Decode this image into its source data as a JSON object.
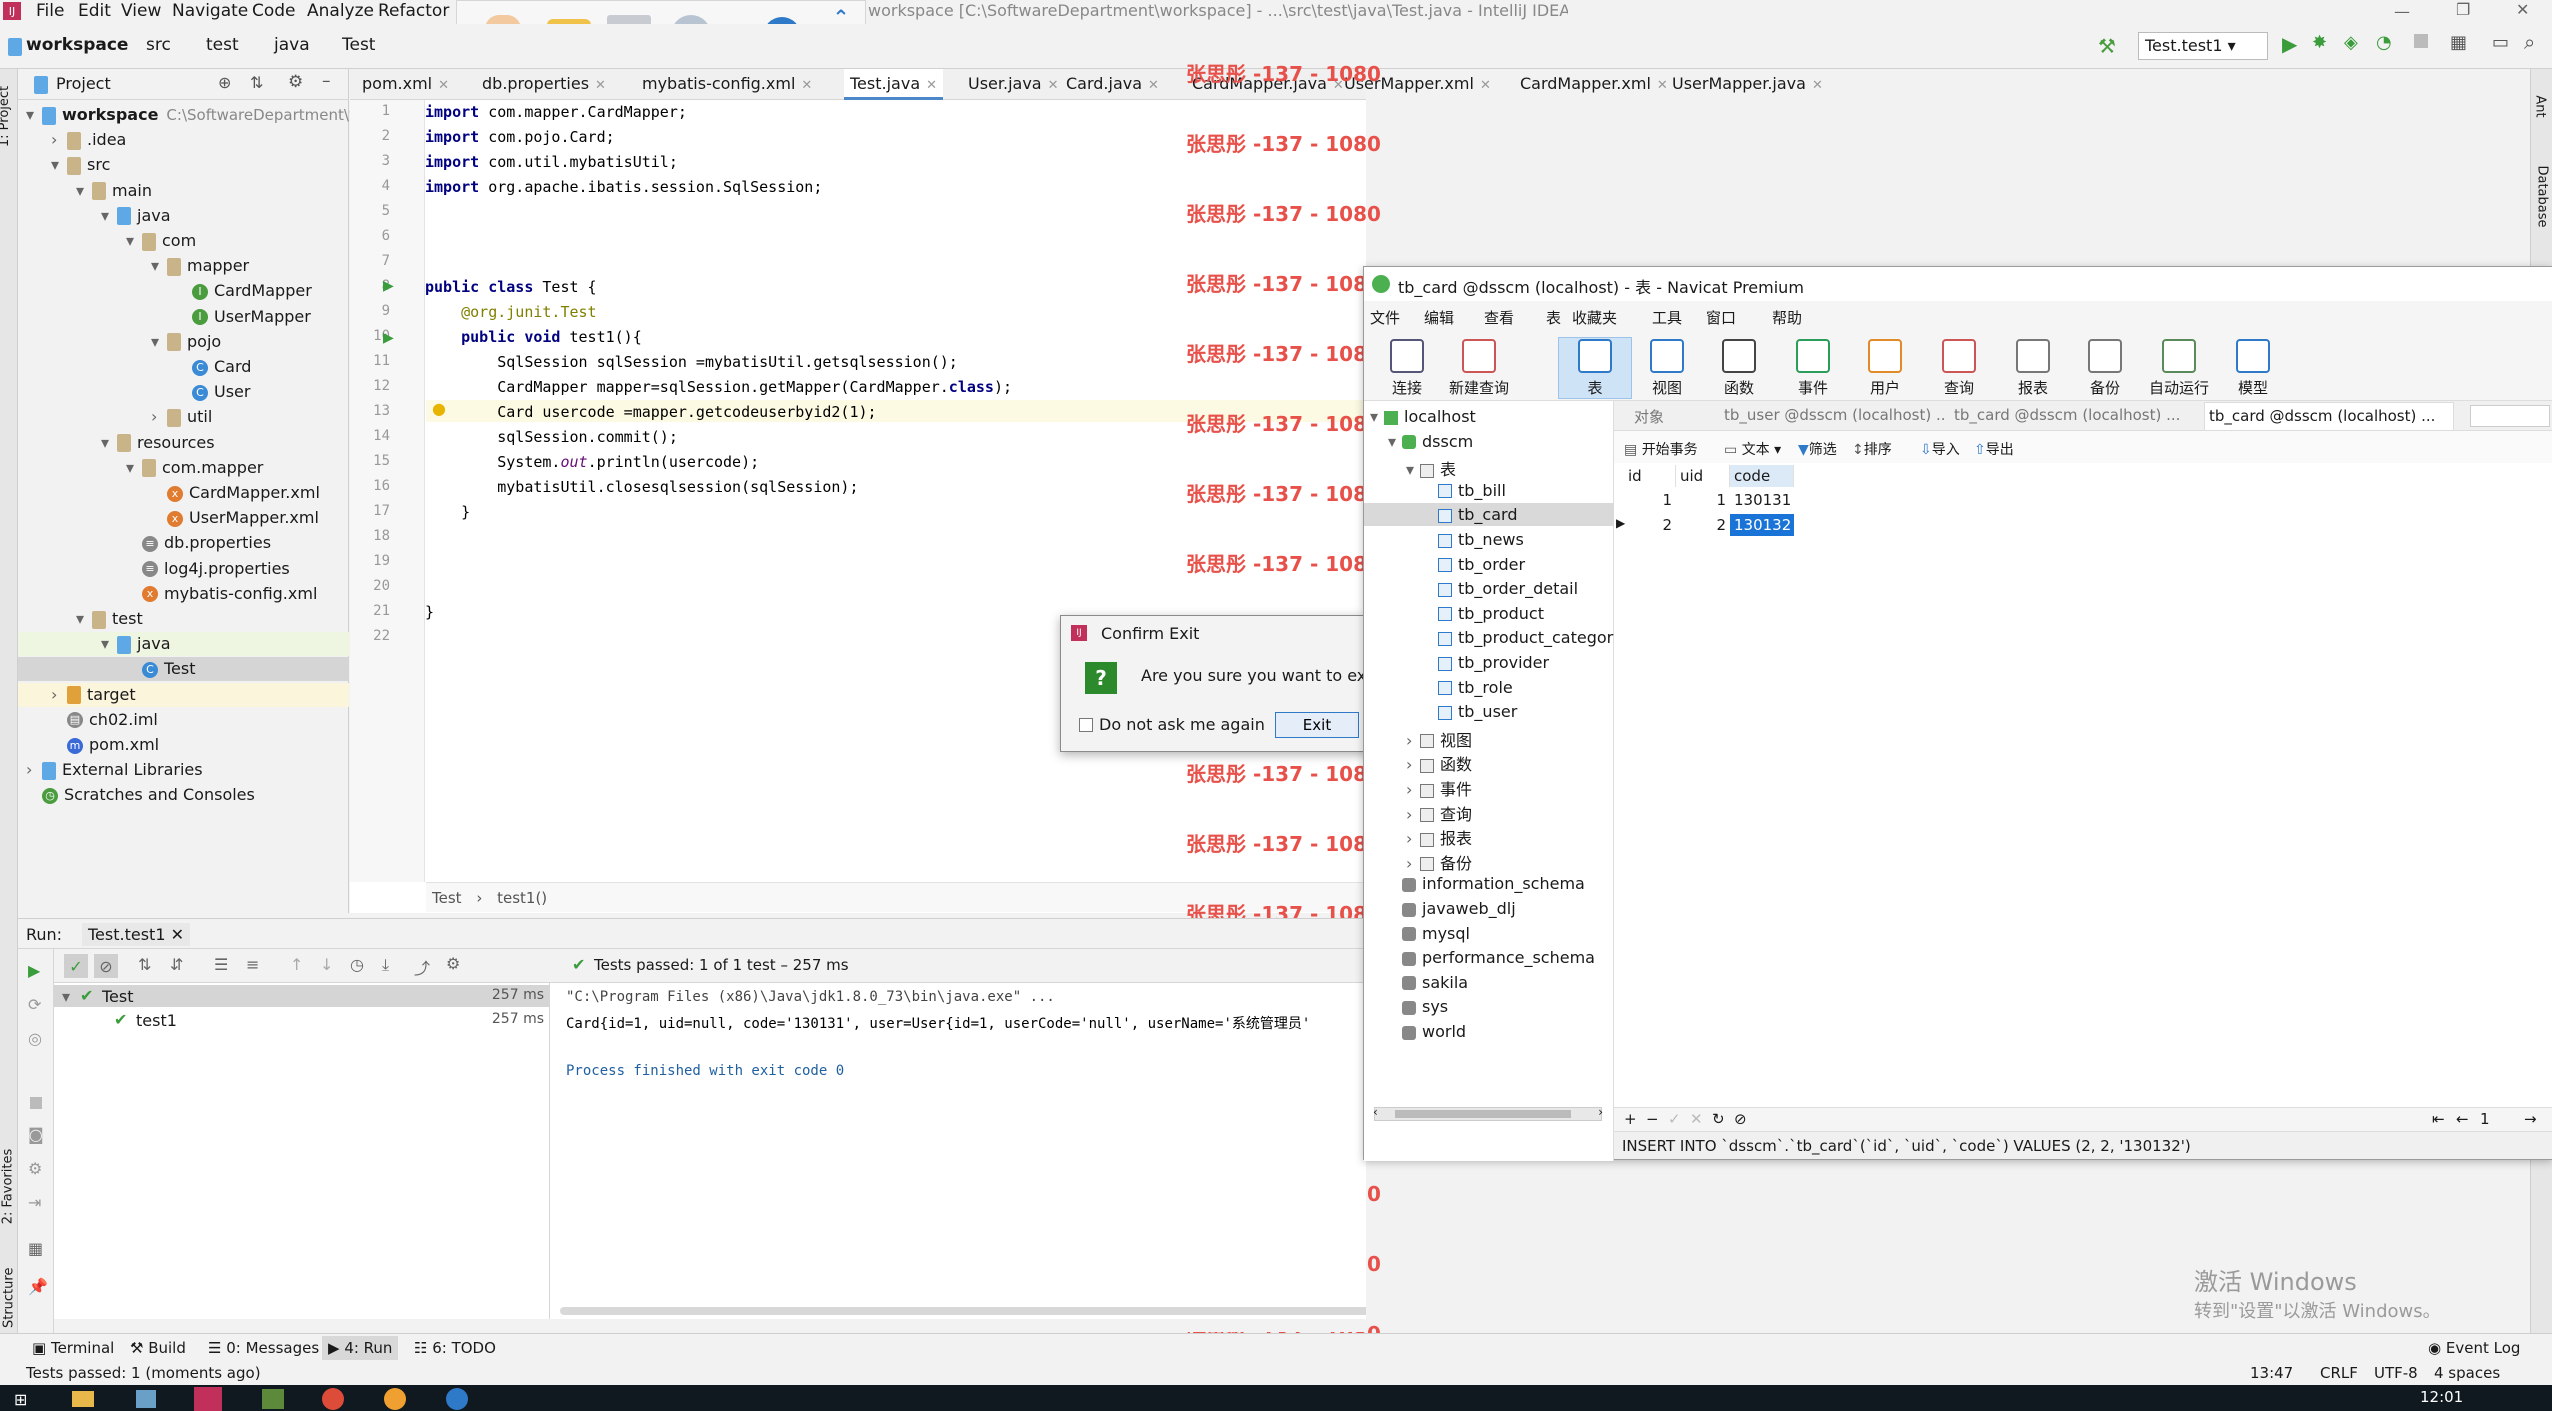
{
  "window_title": "workspace [C:\\SoftwareDepartment\\workspace] - ...\\src\\test\\java\\Test.java - IntelliJ IDEA (Administrator)",
  "menu": [
    "File",
    "Edit",
    "View",
    "Navigate",
    "Code",
    "Analyze",
    "Refactor"
  ],
  "breadcrumb": [
    "workspace",
    "src",
    "test",
    "java",
    "Test"
  ],
  "run_config": "Test.test1",
  "project": {
    "header": "Project",
    "tree": [
      {
        "label": "workspace",
        "note": "C:\\SoftwareDepartment\\w"
      },
      {
        "label": ".idea"
      },
      {
        "label": "src"
      },
      {
        "label": "main"
      },
      {
        "label": "java"
      },
      {
        "label": "com"
      },
      {
        "label": "mapper"
      },
      {
        "label": "CardMapper"
      },
      {
        "label": "UserMapper"
      },
      {
        "label": "pojo"
      },
      {
        "label": "Card"
      },
      {
        "label": "User"
      },
      {
        "label": "util"
      },
      {
        "label": "resources"
      },
      {
        "label": "com.mapper"
      },
      {
        "label": "CardMapper.xml"
      },
      {
        "label": "UserMapper.xml"
      },
      {
        "label": "db.properties"
      },
      {
        "label": "log4j.properties"
      },
      {
        "label": "mybatis-config.xml"
      },
      {
        "label": "test"
      },
      {
        "label": "java"
      },
      {
        "label": "Test"
      },
      {
        "label": "target"
      },
      {
        "label": "ch02.iml"
      },
      {
        "label": "pom.xml"
      },
      {
        "label": "External Libraries"
      },
      {
        "label": "Scratches and Consoles"
      }
    ]
  },
  "editor_tabs": [
    "pom.xml",
    "db.properties",
    "mybatis-config.xml",
    "Test.java",
    "User.java",
    "Card.java",
    "CardMapper.java",
    "UserMapper.xml",
    "CardMapper.xml",
    "UserMapper.java"
  ],
  "code_lines": [
    "import com.mapper.CardMapper;",
    "import com.pojo.Card;",
    "import com.util.mybatisUtil;",
    "import org.apache.ibatis.session.SqlSession;",
    "",
    "",
    "",
    "public class Test {",
    "    @org.junit.Test",
    "    public void test1(){",
    "        SqlSession sqlSession =mybatisUtil.getsqlsession();",
    "        CardMapper mapper=sqlSession.getMapper(CardMapper.class);",
    "        Card usercode =mapper.getcodeuserbyid2(1);",
    "        sqlSession.commit();",
    "        System.out.println(usercode);",
    "        mybatisUtil.closesqlsession(sqlSession);",
    "    }",
    "",
    "",
    "",
    "}",
    ""
  ],
  "editor_breadcrumb": [
    "Test",
    "test1()"
  ],
  "watermark": "张思彤 -137 - 1080",
  "run": {
    "label": "Run:",
    "tab": "Test.test1",
    "status": "Tests passed: 1 of 1 test – 257 ms",
    "tree": [
      {
        "label": "Test",
        "time": "257 ms"
      },
      {
        "label": "test1",
        "time": "257 ms"
      }
    ],
    "console": [
      "\"C:\\Program Files (x86)\\Java\\jdk1.8.0_73\\bin\\java.exe\" ...",
      "Card{id=1, uid=null, code='130131', user=User{id=1, userCode='null', userName='系统管理员'",
      "",
      "Process finished with exit code 0"
    ]
  },
  "dialog": {
    "title": "Confirm Exit",
    "message": "Are you sure you want to exit I",
    "checkbox": "Do not ask me again",
    "button": "Exit"
  },
  "navicat": {
    "title": "tb_card @dsscm (localhost) - 表 - Navicat Premium",
    "menu": [
      "文件",
      "编辑",
      "查看",
      "表",
      "收藏夹",
      "工具",
      "窗口",
      "帮助"
    ],
    "toolbar": [
      "连接",
      "新建查询",
      "表",
      "视图",
      "函数",
      "事件",
      "用户",
      "查询",
      "报表",
      "备份",
      "自动运行",
      "模型"
    ],
    "tabs": [
      "对象",
      "tb_user @dsscm (localhost) ...",
      "tb_card @dsscm (localhost) ...",
      "tb_card @dsscm (localhost) ..."
    ],
    "subtoolbar": [
      "开始事务",
      "文本",
      "筛选",
      "排序",
      "导入",
      "导出"
    ],
    "tree": [
      "localhost",
      "dsscm",
      "表",
      "tb_bill",
      "tb_card",
      "tb_news",
      "tb_order",
      "tb_order_detail",
      "tb_product",
      "tb_product_category",
      "tb_provider",
      "tb_role",
      "tb_user",
      "视图",
      "函数",
      "事件",
      "查询",
      "报表",
      "备份",
      "information_schema",
      "javaweb_dlj",
      "mysql",
      "performance_schema",
      "sakila",
      "sys",
      "world"
    ],
    "columns": [
      "id",
      "uid",
      "code"
    ],
    "rows": [
      [
        "1",
        "1",
        "130131"
      ],
      [
        "2",
        "2",
        "130132"
      ]
    ],
    "sql": "INSERT INTO `dsscm`.`tb_card`(`id`, `uid`, `code`) VALUES (2, 2, '130132')",
    "page": "1"
  },
  "bottom_tabs": [
    "Terminal",
    "Build",
    "0: Messages",
    "4: Run",
    "6: TODO",
    "Event Log"
  ],
  "status": {
    "left": "Tests passed: 1 (moments ago)",
    "pos": "13:47",
    "crlf": "CRLF",
    "enc": "UTF-8",
    "indent": "4 spaces"
  },
  "activate": [
    "激活 Windows",
    "转到\"设置\"以激活 Windows。"
  ],
  "clock": "12:01",
  "side_left": [
    "1: Project",
    "2: Favorites",
    "Z: Structure"
  ],
  "side_right": [
    "Ant",
    "Database"
  ]
}
